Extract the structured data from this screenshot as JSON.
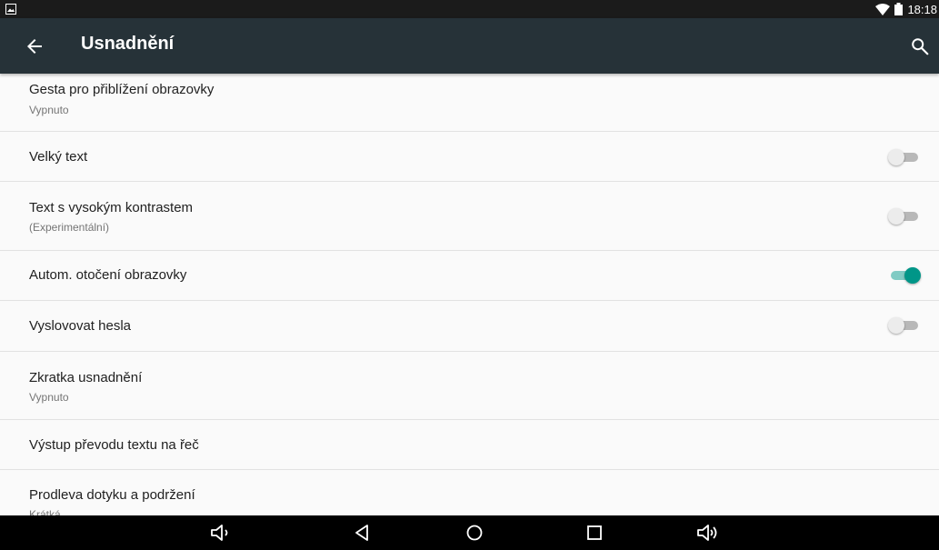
{
  "status_bar": {
    "time": "18:18"
  },
  "app_bar": {
    "title": "Usnadnění"
  },
  "items": [
    {
      "title": "Gesta pro přiblížení obrazovky",
      "summary": "Vypnuto"
    },
    {
      "title": "Velký text",
      "toggle": "off"
    },
    {
      "title": "Text s vysokým kontrastem",
      "summary": "(Experimentální)",
      "toggle": "off"
    },
    {
      "title": "Autom. otočení obrazovky",
      "toggle": "on"
    },
    {
      "title": "Vyslovovat hesla",
      "toggle": "off"
    },
    {
      "title": "Zkratka usnadnění",
      "summary": "Vypnuto"
    },
    {
      "title": "Výstup převodu textu na řeč"
    },
    {
      "title": "Prodleva dotyku a podržení",
      "summary": "Krátká"
    }
  ],
  "colors": {
    "status_bar": "#1b1b1b",
    "app_bar": "#263238",
    "accent": "#009688",
    "background": "#fafafa"
  },
  "icons": {
    "notification": "image-notification-icon",
    "wifi": "wifi-icon",
    "battery": "battery-icon",
    "back": "back-arrow-icon",
    "search": "search-icon"
  },
  "nav_bar": [
    "volume-down-icon",
    "back-triangle-icon",
    "home-circle-icon",
    "recents-square-icon",
    "volume-up-icon"
  ]
}
